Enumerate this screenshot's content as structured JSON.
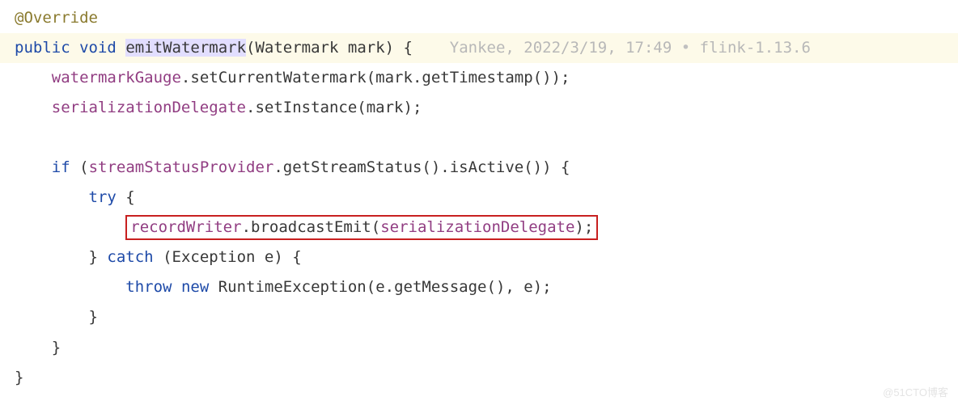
{
  "code": {
    "annotation": "@Override",
    "signature": {
      "modifier1": "public",
      "modifier2": "void",
      "methodName": "emitWatermark",
      "paramType": "Watermark",
      "paramName": "mark"
    },
    "commit": {
      "author": "Yankee",
      "date": "2022/3/19, 17:49",
      "bullet": "•",
      "project": "flink-1.13.6"
    },
    "lines": {
      "l1_obj": "watermarkGauge",
      "l1_m1": "setCurrentWatermark",
      "l1_arg": "mark",
      "l1_m2": "getTimestamp",
      "l2_obj": "serializationDelegate",
      "l2_m": "setInstance",
      "l2_arg": "mark",
      "if_kw": "if",
      "if_obj": "streamStatusProvider",
      "if_m1": "getStreamStatus",
      "if_m2": "isActive",
      "try_kw": "try",
      "hl_obj": "recordWriter",
      "hl_m": "broadcastEmit",
      "hl_arg": "serializationDelegate",
      "catch_kw": "catch",
      "catch_type": "Exception",
      "catch_name": "e",
      "throw_kw": "throw",
      "new_kw": "new",
      "throw_type": "RuntimeException",
      "throw_arg1": "e",
      "throw_m": "getMessage",
      "throw_arg2": "e"
    }
  },
  "watermark": "@51CTO博客"
}
